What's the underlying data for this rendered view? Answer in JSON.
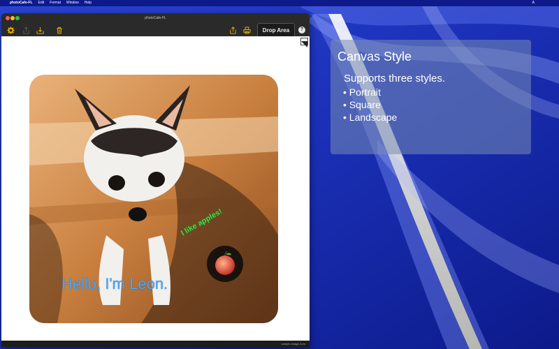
{
  "menubar": {
    "apple": "",
    "app_name": "photoCafe-FL",
    "items": [
      "Edit",
      "Format",
      "Window",
      "Help"
    ],
    "status_items": [
      "",
      "",
      "A",
      "",
      "",
      ""
    ]
  },
  "window": {
    "title": "photoCafe-FL",
    "toolbar": {
      "drop_area_label": "Drop Area",
      "help_label": "?"
    },
    "canvas": {
      "bubble_text": "I like apples!",
      "caption": "Hello, I'm Leon."
    },
    "status_text": "sample-image-3-en"
  },
  "panel": {
    "title": "Canvas Style",
    "subtitle": "Supports three styles.",
    "items": [
      "Portrait",
      "Square",
      "Landscape"
    ]
  },
  "colors": {
    "accent_blue": "#4aa8ff",
    "bubble_green": "#3fe24a",
    "desktop_blue": "#1730b8"
  }
}
